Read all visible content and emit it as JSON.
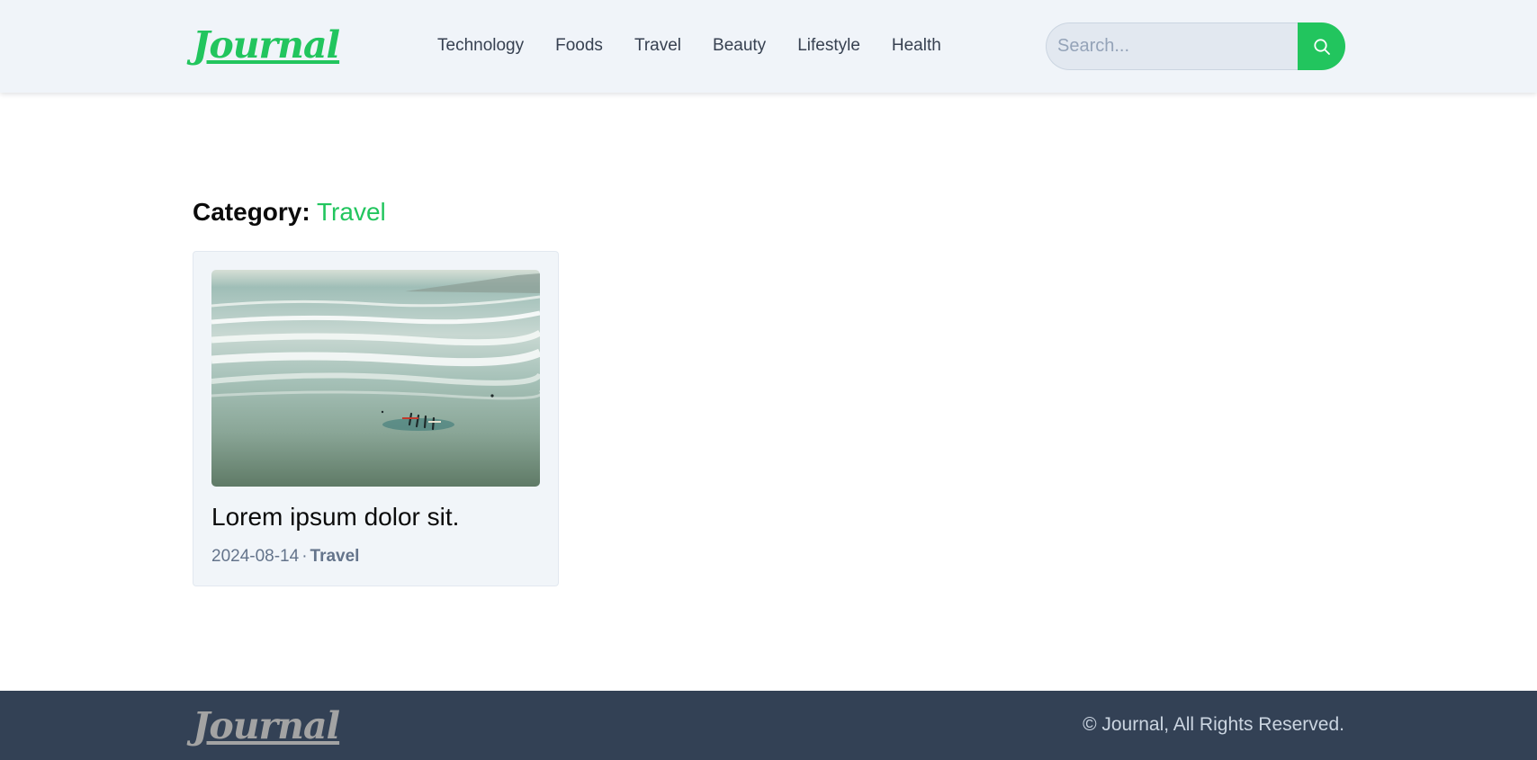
{
  "header": {
    "logo": "Journal",
    "nav": [
      {
        "label": "Technology"
      },
      {
        "label": "Foods"
      },
      {
        "label": "Travel"
      },
      {
        "label": "Beauty"
      },
      {
        "label": "Lifestyle"
      },
      {
        "label": "Health"
      }
    ],
    "search": {
      "placeholder": "Search...",
      "value": "",
      "button_icon": "search-icon"
    }
  },
  "main": {
    "category_label": "Category:",
    "category_name": "Travel",
    "posts": [
      {
        "image_icon": "beach-surfers-photo",
        "title": "Lorem ipsum dolor sit.",
        "date": "2024-08-14",
        "separator": "·",
        "category": "Travel"
      }
    ]
  },
  "footer": {
    "logo": "Journal",
    "copyright": "© Journal, All Rights Reserved."
  },
  "colors": {
    "accent": "#22c55e",
    "header_bg": "#f0f4f9",
    "footer_bg": "#334155",
    "card_bg": "#f1f5f9"
  }
}
